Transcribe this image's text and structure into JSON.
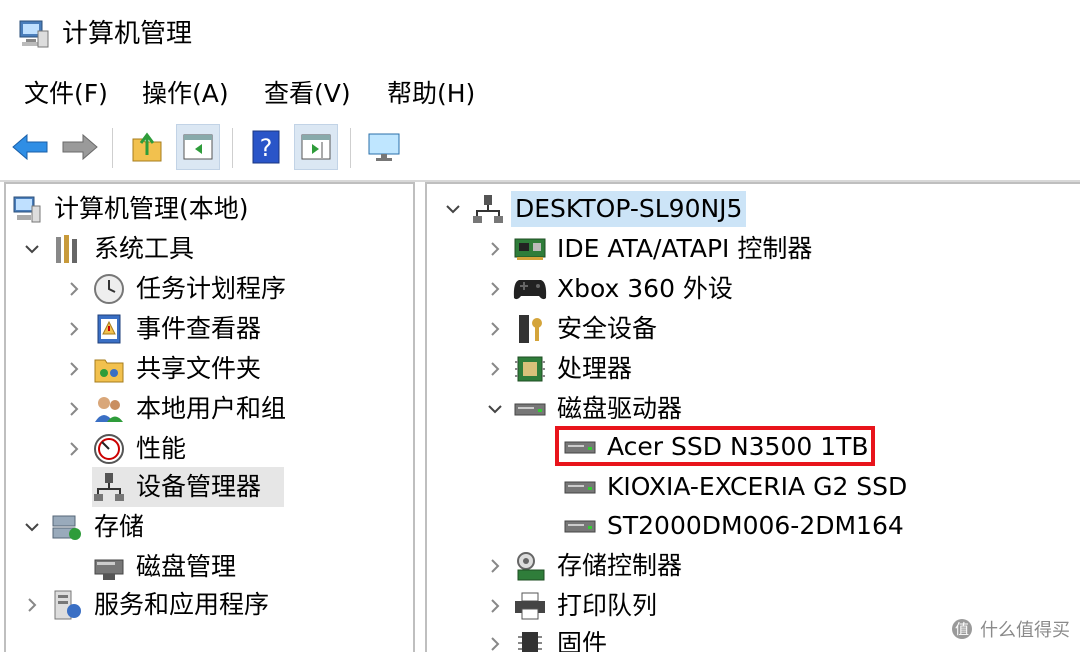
{
  "window": {
    "title": "计算机管理",
    "icon": "computer-management-icon"
  },
  "menu": [
    "文件(F)",
    "操作(A)",
    "查看(V)",
    "帮助(H)"
  ],
  "toolbar": [
    "back-arrow-icon",
    "forward-arrow-icon",
    "up-folder-icon",
    "show-hide-tree-icon",
    "help-icon",
    "show-hide-action-pane-icon",
    "monitor-icon"
  ],
  "left_tree": {
    "root": "计算机管理(本地)",
    "system_tools": "系统工具",
    "task_scheduler": "任务计划程序",
    "event_viewer": "事件查看器",
    "shared_folders": "共享文件夹",
    "local_users": "本地用户和组",
    "performance": "性能",
    "device_manager": "设备管理器",
    "storage": "存储",
    "disk_management": "磁盘管理",
    "services_apps": "服务和应用程序"
  },
  "right_tree": {
    "computer": "DESKTOP-SL90NJ5",
    "ide": "IDE ATA/ATAPI 控制器",
    "xbox": "Xbox 360 外设",
    "security": "安全设备",
    "processor": "处理器",
    "disk_drives": "磁盘驱动器",
    "disks": [
      "Acer SSD N3500 1TB",
      "KIOXIA-EXCERIA G2 SSD",
      "ST2000DM006-2DM164"
    ],
    "storage_ctrl": "存储控制器",
    "print_queue": "打印队列",
    "firmware": "固件"
  },
  "watermark": "什么值得买",
  "colors": {
    "highlight_border": "#e8141b",
    "selection": "#cce4f7",
    "inactive_selection": "#e6e6e6"
  }
}
